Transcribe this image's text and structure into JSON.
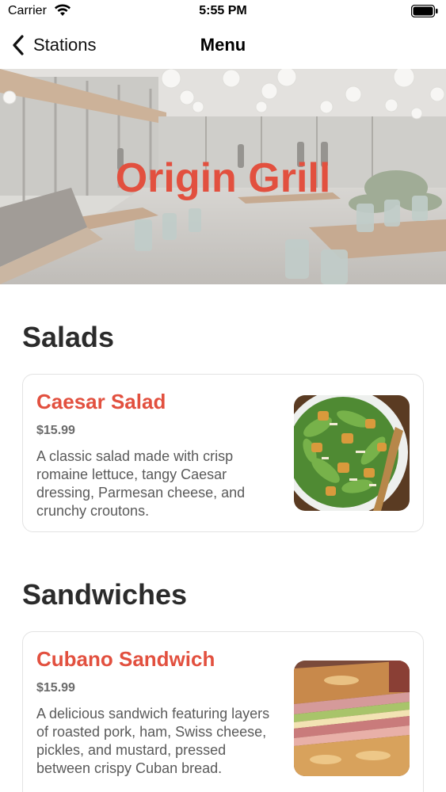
{
  "status_bar": {
    "carrier": "Carrier",
    "time": "5:55 PM"
  },
  "nav": {
    "back_label": "Stations",
    "title": "Menu"
  },
  "hero": {
    "station_name": "Origin Grill",
    "accent_color": "#e2503f"
  },
  "sections": [
    {
      "title": "Salads",
      "items": [
        {
          "name": "Caesar Salad",
          "price": "$15.99",
          "description": "A classic salad made with crisp romaine lettuce, tangy Caesar dressing, Parmesan cheese, and crunchy croutons.",
          "photo": "caesar-salad-photo"
        }
      ]
    },
    {
      "title": "Sandwiches",
      "items": [
        {
          "name": "Cubano Sandwich",
          "price": "$15.99",
          "description": "A delicious sandwich featuring layers of roasted pork, ham, Swiss cheese, pickles, and mustard, pressed between crispy Cuban bread.",
          "photo": "cubano-sandwich-photo"
        }
      ]
    }
  ]
}
